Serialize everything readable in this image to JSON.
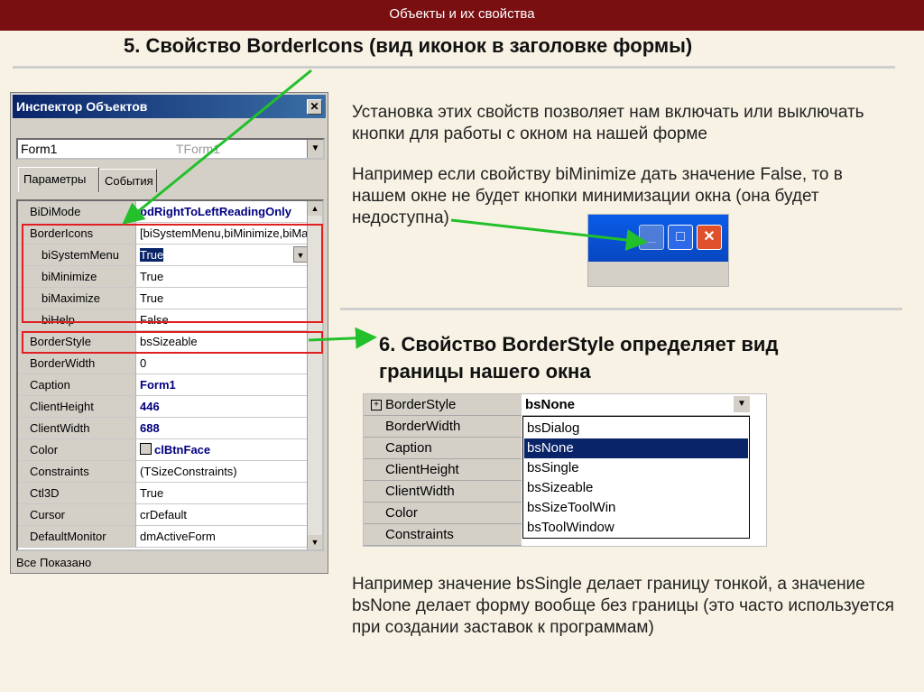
{
  "slide": {
    "top_title": "Объекты и их свойства",
    "heading1": "5. Свойство BorderIcons (вид иконок в заголовке формы)",
    "para1": "Установка этих свойств позволяет нам включать или выключать кнопки для работы с окном на нашей форме",
    "para2": "Например если свойству biMinimize дать значение False, то в нашем окне не будет кнопки минимизации окна (она будет недоступна)",
    "heading2_line1": "6. Свойство BorderStyle определяет вид",
    "heading2_line2": "границы нашего окна",
    "para3": "Например значение bsSingle делает границу тонкой, а значение bsNone делает форму вообще без границы (это часто используется при создании заставок к программам)"
  },
  "inspector": {
    "title": "Инспектор Объектов",
    "close_glyph": "✕",
    "object": "Form1",
    "object_class": "TForm1",
    "tabs": [
      "Параметры",
      "События"
    ],
    "status": "Все Показано",
    "rows": [
      {
        "name": "BiDiMode",
        "value": "bdRightToLeftReadingOnly",
        "bold": true,
        "sub": false,
        "expand": false
      },
      {
        "name": "BorderIcons",
        "value": "[biSystemMenu,biMinimize,biMaximi",
        "bold": false,
        "sub": false,
        "expand": true
      },
      {
        "name": "biSystemMenu",
        "value": "True",
        "bold": false,
        "sub": true,
        "expand": false,
        "edit": true
      },
      {
        "name": "biMinimize",
        "value": "True",
        "bold": false,
        "sub": true,
        "expand": false
      },
      {
        "name": "biMaximize",
        "value": "True",
        "bold": false,
        "sub": true,
        "expand": false
      },
      {
        "name": "biHelp",
        "value": "False",
        "bold": false,
        "sub": true,
        "expand": false
      },
      {
        "name": "BorderStyle",
        "value": "bsSizeable",
        "bold": false,
        "sub": false,
        "expand": false
      },
      {
        "name": "BorderWidth",
        "value": "0",
        "bold": false,
        "sub": false,
        "expand": false
      },
      {
        "name": "Caption",
        "value": "Form1",
        "bold": true,
        "sub": false,
        "expand": false
      },
      {
        "name": "ClientHeight",
        "value": "446",
        "bold": true,
        "sub": false,
        "expand": false
      },
      {
        "name": "ClientWidth",
        "value": "688",
        "bold": true,
        "sub": false,
        "expand": false
      },
      {
        "name": "Color",
        "value": "clBtnFace",
        "bold": true,
        "sub": false,
        "expand": false,
        "swatch": true
      },
      {
        "name": "Constraints",
        "value": "(TSizeConstraints)",
        "bold": false,
        "sub": false,
        "expand": true
      },
      {
        "name": "Ctl3D",
        "value": "True",
        "bold": false,
        "sub": false,
        "expand": false
      },
      {
        "name": "Cursor",
        "value": "crDefault",
        "bold": false,
        "sub": false,
        "expand": false
      },
      {
        "name": "DefaultMonitor",
        "value": "dmActiveForm",
        "bold": false,
        "sub": false,
        "expand": false
      }
    ]
  },
  "window_buttons": {
    "minimize": "_",
    "maximize": "□",
    "close": "✕"
  },
  "borderstyle_demo": {
    "rows": [
      "BorderStyle",
      "BorderWidth",
      "Caption",
      "ClientHeight",
      "ClientWidth",
      "Color",
      "Constraints"
    ],
    "current_value": "bsNone",
    "options": [
      "bsDialog",
      "bsNone",
      "bsSingle",
      "bsSizeable",
      "bsSizeToolWin",
      "bsToolWindow"
    ],
    "selected": "bsNone"
  },
  "colors": {
    "topbar": "#7a0f12",
    "arrow": "#22c02a",
    "highlight_box": "#e02020",
    "selection": "#0a246a"
  }
}
